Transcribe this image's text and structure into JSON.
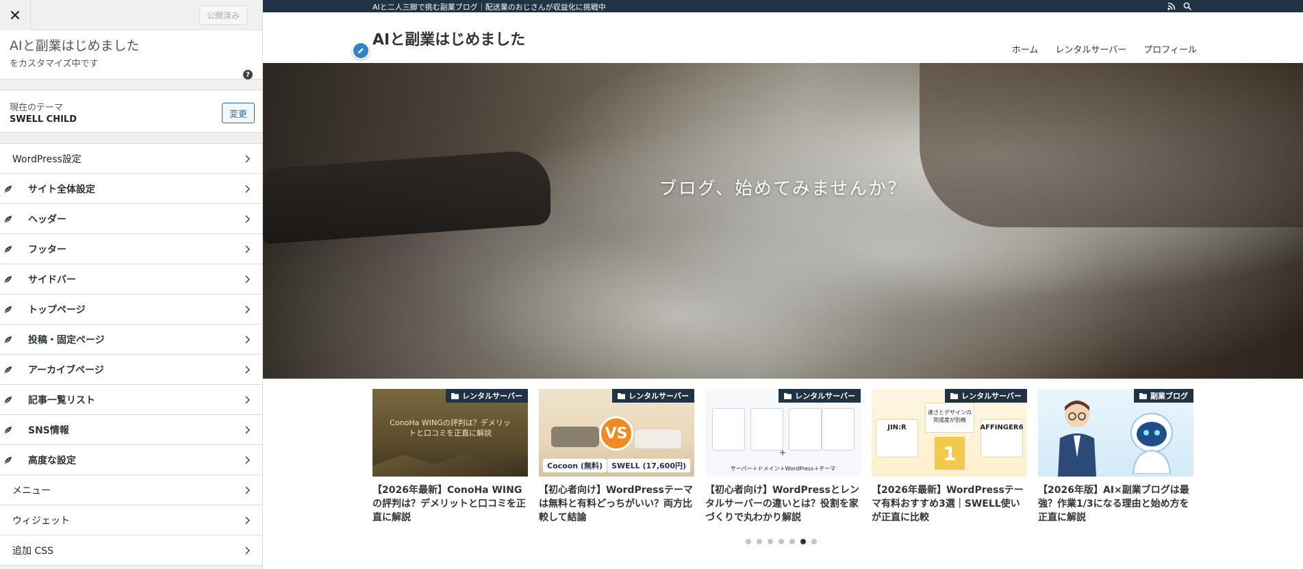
{
  "sidebar": {
    "publish_label": "公開済み",
    "site_title": "AIと副業はじめました",
    "subtitle": "をカスタマイズ中です",
    "theme_label": "現在のテーマ",
    "theme_name": "SWELL CHILD",
    "change_label": "変更",
    "items": [
      {
        "label": "WordPress設定",
        "swell": false
      },
      {
        "label": "サイト全体設定",
        "swell": true
      },
      {
        "label": "ヘッダー",
        "swell": true
      },
      {
        "label": "フッター",
        "swell": true
      },
      {
        "label": "サイドバー",
        "swell": true
      },
      {
        "label": "トップページ",
        "swell": true
      },
      {
        "label": "投稿・固定ページ",
        "swell": true
      },
      {
        "label": "アーカイブページ",
        "swell": true
      },
      {
        "label": "記事一覧リスト",
        "swell": true
      },
      {
        "label": "SNS情報",
        "swell": true
      },
      {
        "label": "高度な設定",
        "swell": true
      },
      {
        "label": "メニュー",
        "swell": false
      },
      {
        "label": "ウィジェット",
        "swell": false
      },
      {
        "label": "追加 CSS",
        "swell": false
      }
    ]
  },
  "preview": {
    "topbar_text": "AIと二人三脚で挑む副業ブログ｜配送業のおじさんが収益化に挑戦中",
    "site_logo": "AIと副業はじめました",
    "nav": [
      "ホーム",
      "レンタルサーバー",
      "プロフィール"
    ],
    "hero_text": "ブログ、始めてみませんか？",
    "posts": [
      {
        "category": "レンタルサーバー",
        "title": "【2026年最新】ConoHa WINGの評判は？デメリットと口コミを正直に解説",
        "thumb_text": "ConoHa WINGの評判は？デメリットと口コミを正直に解説"
      },
      {
        "category": "レンタルサーバー",
        "title": "【初心者向け】WordPressテーマは無料と有料どっちがいい？両方比較して結論",
        "thumb_left": "Cocoon (無料)",
        "thumb_vs": "VS",
        "thumb_right": "SWELL (17,600円)"
      },
      {
        "category": "レンタルサーバー",
        "title": "【初心者向け】WordPressとレンタルサーバーの違いとは？役割を家づくりで丸わかり解説",
        "thumb_plus": "+",
        "thumb_line": "サーバー＋ドメイン＋WordPress＋テーマ"
      },
      {
        "category": "レンタルサーバー",
        "title": "【2026年最新】WordPressテーマ有料おすすめ3選｜SWELL使いが正直に比較",
        "thumb_head": "速さとデザインの完成度が別格",
        "thumb_left": "JIN:R",
        "thumb_one": "1",
        "thumb_right": "AFFINGER6"
      },
      {
        "category": "副業ブログ",
        "title": "【2026年版】AI×副業ブログは最強？作業1/3になる理由と始め方を正直に解説"
      }
    ],
    "slider_total": 7,
    "slider_active": 6
  },
  "colors": {
    "dark_navy": "#1f3344",
    "wp_blue": "#2271b1",
    "pencil_blue": "#3582c4"
  }
}
